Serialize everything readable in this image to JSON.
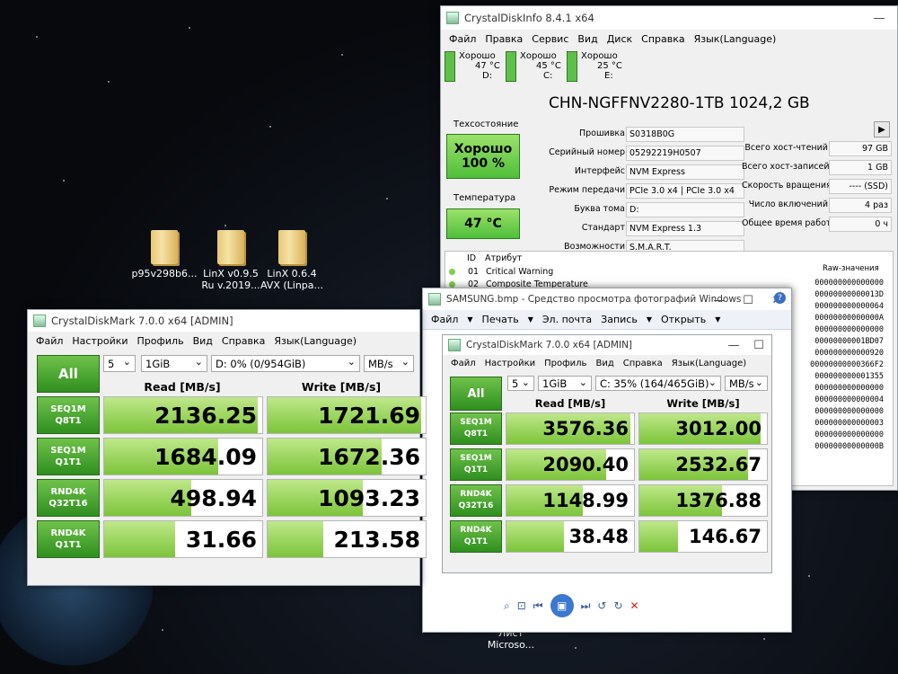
{
  "desktop": {
    "icons": [
      {
        "label": "p95v298b6..."
      },
      {
        "label": "LinX v0.9.5 Ru v.2019..."
      },
      {
        "label": "LinX 0.6.4 AVX (Linpa..."
      },
      {
        "label": "Лист Microso..."
      }
    ]
  },
  "cdi": {
    "title": "CrystalDiskInfo 8.4.1 x64",
    "menu": [
      "Файл",
      "Правка",
      "Сервис",
      "Вид",
      "Диск",
      "Справка",
      "Язык(Language)"
    ],
    "disks": [
      {
        "status": "Хорошо",
        "temp": "47 °C",
        "letter": "D:"
      },
      {
        "status": "Хорошо",
        "temp": "45 °C",
        "letter": "C:"
      },
      {
        "status": "Хорошо",
        "temp": "25 °C",
        "letter": "E:"
      }
    ],
    "model": "CHN-NGFFNV2280-1TB 1024,2 GB",
    "health_label": "Техсостояние",
    "health_status": "Хорошо",
    "health_pct": "100 %",
    "temp_label": "Температура",
    "temp_value": "47 °C",
    "fields": [
      {
        "label": "Прошивка",
        "value": "S0318B0G"
      },
      {
        "label": "Серийный номер",
        "value": "05292219H0507"
      },
      {
        "label": "Интерфейс",
        "value": "NVM Express"
      },
      {
        "label": "Режим передачи",
        "value": "PCIe 3.0 x4 | PCIe 3.0 x4"
      },
      {
        "label": "Буква тома",
        "value": "D:"
      },
      {
        "label": "Стандарт",
        "value": "NVM Express 1.3"
      },
      {
        "label": "Возможности",
        "value": "S.M.A.R.T."
      }
    ],
    "right_fields": [
      {
        "label": "Всего хост-чтений",
        "value": "97 GB"
      },
      {
        "label": "Всего хост-записей",
        "value": "1 GB"
      },
      {
        "label": "Скорость вращения",
        "value": "---- (SSD)"
      },
      {
        "label": "Число включений",
        "value": "4 раз"
      },
      {
        "label": "Общее время работы",
        "value": "0 ч"
      }
    ],
    "attr_header": {
      "id": "ID",
      "name": "Атрибут",
      "raw": "Raw-значения"
    },
    "attrs": [
      {
        "id": "01",
        "name": "Critical Warning"
      },
      {
        "id": "02",
        "name": "Composite Temperature"
      }
    ],
    "raw_values": [
      "000000000000000",
      "00000000000013D",
      "000000000000064",
      "00000000000000A",
      "000000000000000",
      "00000000001BD07",
      "000000000000920",
      "00000000000366F2",
      "000000000001355",
      "000000000000000",
      "000000000000004",
      "000000000000000",
      "000000000000003",
      "000000000000000",
      "00000000000000B"
    ]
  },
  "photo_viewer": {
    "title": "SAMSUNG.bmp - Средство просмотра фотографий Windows",
    "menu": [
      "Файл",
      "Печать",
      "Эл. почта",
      "Запись",
      "Открыть"
    ]
  },
  "cdm_left": {
    "title": "CrystalDiskMark 7.0.0 x64 [ADMIN]",
    "menu": [
      "Файл",
      "Настройки",
      "Профиль",
      "Вид",
      "Справка",
      "Язык(Language)"
    ],
    "all_label": "All",
    "count": "5",
    "size": "1GiB",
    "drive": "D: 0% (0/954GiB)",
    "unit": "MB/s",
    "read_header": "Read [MB/s]",
    "write_header": "Write [MB/s]",
    "rows": [
      {
        "l1": "SEQ1M",
        "l2": "Q8T1",
        "read": "2136.25",
        "write": "1721.69",
        "rf": 0.97,
        "wf": 0.97
      },
      {
        "l1": "SEQ1M",
        "l2": "Q1T1",
        "read": "1684.09",
        "write": "1672.36",
        "rf": 0.72,
        "wf": 0.72
      },
      {
        "l1": "RND4K",
        "l2": "Q32T16",
        "read": "498.94",
        "write": "1093.23",
        "rf": 0.55,
        "wf": 0.6
      },
      {
        "l1": "RND4K",
        "l2": "Q1T1",
        "read": "31.66",
        "write": "213.58",
        "rf": 0.45,
        "wf": 0.35
      }
    ]
  },
  "cdm_right": {
    "title": "CrystalDiskMark 7.0.0 x64 [ADMIN]",
    "menu": [
      "Файл",
      "Настройки",
      "Профиль",
      "Вид",
      "Справка",
      "Язык(Language)"
    ],
    "all_label": "All",
    "count": "5",
    "size": "1GiB",
    "drive": "C: 35% (164/465GiB)",
    "unit": "MB/s",
    "read_header": "Read [MB/s]",
    "write_header": "Write [MB/s]",
    "rows": [
      {
        "l1": "SEQ1M",
        "l2": "Q8T1",
        "read": "3576.36",
        "write": "3012.00",
        "rf": 0.97,
        "wf": 0.95
      },
      {
        "l1": "SEQ1M",
        "l2": "Q1T1",
        "read": "2090.40",
        "write": "2532.67",
        "rf": 0.78,
        "wf": 0.85
      },
      {
        "l1": "RND4K",
        "l2": "Q32T16",
        "read": "1148.99",
        "write": "1376.88",
        "rf": 0.6,
        "wf": 0.65
      },
      {
        "l1": "RND4K",
        "l2": "Q1T1",
        "read": "38.48",
        "write": "146.67",
        "rf": 0.45,
        "wf": 0.3
      }
    ]
  }
}
